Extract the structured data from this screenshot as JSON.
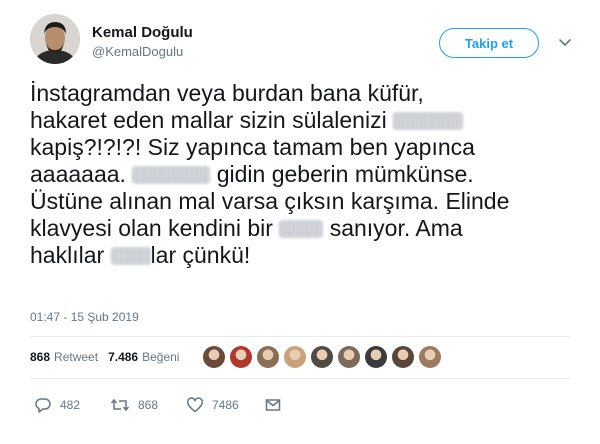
{
  "user": {
    "name": "Kemal Doğulu",
    "handle": "@KemalDogulu"
  },
  "follow_button": {
    "label": "Takip et"
  },
  "tweet": {
    "line1": "İnstagramdan veya burdan bana küfür,",
    "line2a": "hakaret eden mallar sizin sülalenizi",
    "line3": "kapiş?!?!?! Siz yapınca tamam ben yapınca",
    "line4a": "aaaaaaa.",
    "line4b": "gidin geberin mümkünse.",
    "line5": "Üstüne alınan mal varsa çıksın karşıma. Elinde",
    "line6a": "klavyesi olan kendini bir",
    "line6b": "sanıyor. Ama",
    "line7a": "haklılar",
    "line7b": "lar çünkü!"
  },
  "timestamp": "01:47 - 15 Şub 2019",
  "stats": {
    "retweet_count": "868",
    "retweet_label": "Retweet",
    "like_count": "7.486",
    "like_label": "Beğeni"
  },
  "likers_colors": [
    "#6b4a3a",
    "#b0372c",
    "#8a6e55",
    "#c9a27a",
    "#4f4a45",
    "#7d6a5c",
    "#3b3b3b",
    "#5a4638",
    "#9c7a60"
  ],
  "actions": {
    "reply_count": "482",
    "retweet_count": "868",
    "like_count": "7486"
  },
  "colors": {
    "accent": "#1da1f2",
    "muted": "#657786",
    "text": "#14171a"
  }
}
